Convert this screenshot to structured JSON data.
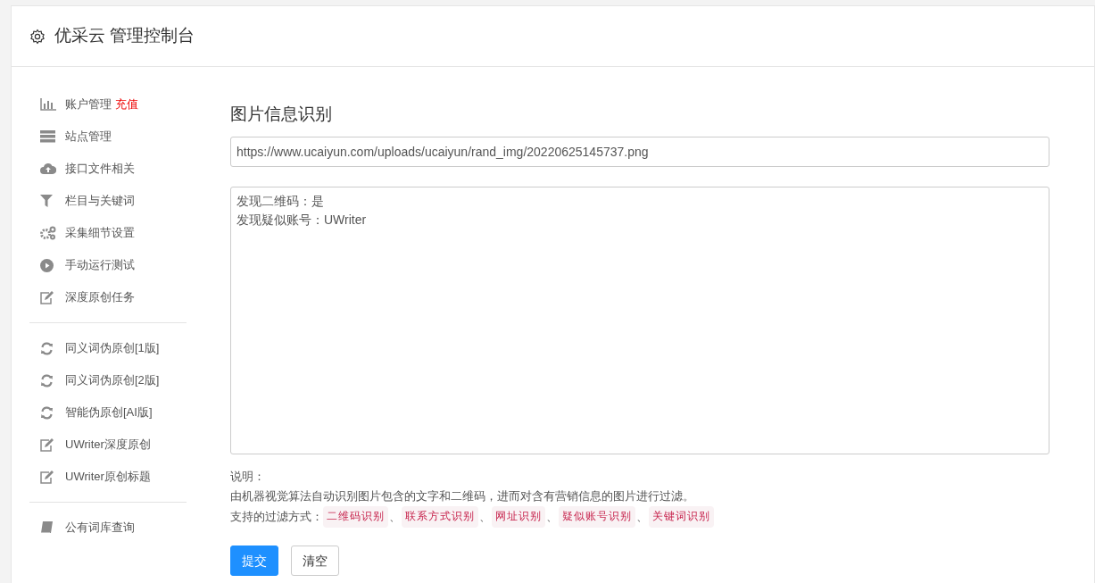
{
  "header": {
    "title": "优采云 管理控制台"
  },
  "sidebar": {
    "groups": [
      {
        "items": [
          {
            "kind": "chart",
            "label": "账户管理",
            "badge": "充值"
          },
          {
            "kind": "server",
            "label": "站点管理"
          },
          {
            "kind": "cloud",
            "label": "接口文件相关"
          },
          {
            "kind": "filter",
            "label": "栏目与关键词"
          },
          {
            "kind": "gears",
            "label": "采集细节设置"
          },
          {
            "kind": "play",
            "label": "手动运行测试"
          },
          {
            "kind": "edit",
            "label": "深度原创任务"
          }
        ]
      },
      {
        "items": [
          {
            "kind": "refresh",
            "label": "同义词伪原创[1版]"
          },
          {
            "kind": "refresh",
            "label": "同义词伪原创[2版]"
          },
          {
            "kind": "refresh",
            "label": "智能伪原创[AI版]"
          },
          {
            "kind": "edit",
            "label": "UWriter深度原创"
          },
          {
            "kind": "edit",
            "label": "UWriter原创标题"
          }
        ]
      },
      {
        "items": [
          {
            "kind": "book",
            "label": "公有词库查询"
          }
        ]
      }
    ]
  },
  "main": {
    "title": "图片信息识别",
    "url_field": {
      "value": "https://www.ucaiyun.com/uploads/ucaiyun/rand_img/20220625145737.png"
    },
    "result_box": {
      "lines": [
        "发现二维码：是",
        "发现疑似账号：UWriter"
      ]
    },
    "notes_heading": "说明：",
    "notes_text": "由机器视觉算法自动识别图片包含的文字和二维码，进而对含有营销信息的图片进行过滤。",
    "filters_label": "支持的过滤方式：",
    "filters": [
      "二维码识别",
      "联系方式识别",
      "网址识别",
      "疑似账号识别",
      "关键词识别"
    ],
    "separator": "、",
    "buttons": [
      {
        "kind": "primary",
        "label": "提交"
      },
      {
        "kind": "default",
        "label": "清空"
      }
    ]
  }
}
